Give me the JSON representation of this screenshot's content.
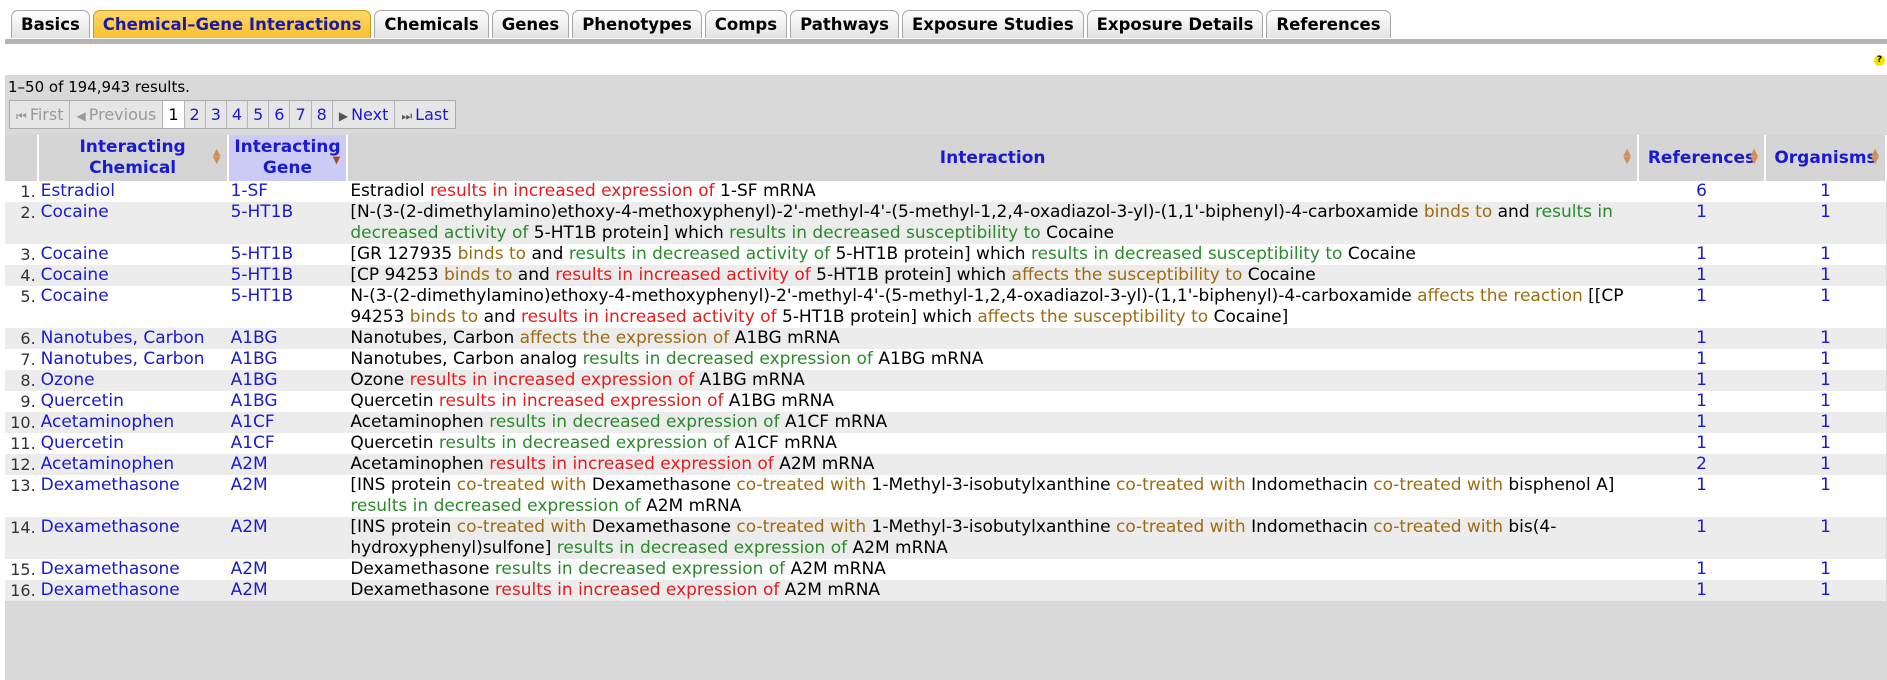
{
  "tabs": [
    {
      "label": "Basics",
      "active": false
    },
    {
      "label": "Chemical–Gene Interactions",
      "active": true
    },
    {
      "label": "Chemicals",
      "active": false
    },
    {
      "label": "Genes",
      "active": false
    },
    {
      "label": "Phenotypes",
      "active": false
    },
    {
      "label": "Comps",
      "active": false
    },
    {
      "label": "Pathways",
      "active": false
    },
    {
      "label": "Exposure Studies",
      "active": false
    },
    {
      "label": "Exposure Details",
      "active": false
    },
    {
      "label": "References",
      "active": false
    }
  ],
  "help_icon": "?",
  "results_count": "1–50 of 194,943 results.",
  "pager": {
    "first": "First",
    "previous": "Previous",
    "pages": [
      "1",
      "2",
      "3",
      "4",
      "5",
      "6",
      "7",
      "8"
    ],
    "current": "1",
    "next": "Next",
    "last": "Last"
  },
  "columns": {
    "chemical": "Interacting Chemical",
    "gene": "Interacting Gene",
    "interaction": "Interaction",
    "references": "References",
    "organisms": "Organisms"
  },
  "colors": {
    "increase": "#e81a1a",
    "decrease": "#2a8a2a",
    "affects": "#9e6b10",
    "link": "#1a1ad0",
    "active_tab": "#fbc02e"
  },
  "rows": [
    {
      "n": "1.",
      "chemical": "Estradiol",
      "gene": "1-SF",
      "refs": "6",
      "orgs": "1",
      "interaction": [
        [
          "Estradiol ",
          ""
        ],
        [
          "results in increased expression of",
          "red"
        ],
        [
          " 1-SF mRNA",
          ""
        ]
      ]
    },
    {
      "n": "2.",
      "chemical": "Cocaine",
      "gene": "5-HT1B",
      "refs": "1",
      "orgs": "1",
      "interaction": [
        [
          "[N-(3-(2-dimethylamino)ethoxy-4-methoxyphenyl)-2'-methyl-4'-(5-methyl-1,2,4-oxadiazol-3-yl)-(1,1'-biphenyl)-4-carboxamide ",
          ""
        ],
        [
          "binds to",
          "brn"
        ],
        [
          " and ",
          ""
        ],
        [
          "results in decreased activity of",
          "grn"
        ],
        [
          " 5-HT1B protein] which ",
          ""
        ],
        [
          "results in decreased susceptibility to",
          "grn"
        ],
        [
          " Cocaine",
          ""
        ]
      ]
    },
    {
      "n": "3.",
      "chemical": "Cocaine",
      "gene": "5-HT1B",
      "refs": "1",
      "orgs": "1",
      "interaction": [
        [
          "[GR 127935 ",
          ""
        ],
        [
          "binds to",
          "brn"
        ],
        [
          " and ",
          ""
        ],
        [
          "results in decreased activity of",
          "grn"
        ],
        [
          " 5-HT1B protein] which ",
          ""
        ],
        [
          "results in decreased susceptibility to",
          "grn"
        ],
        [
          " Cocaine",
          ""
        ]
      ]
    },
    {
      "n": "4.",
      "chemical": "Cocaine",
      "gene": "5-HT1B",
      "refs": "1",
      "orgs": "1",
      "interaction": [
        [
          "[CP 94253 ",
          ""
        ],
        [
          "binds to",
          "brn"
        ],
        [
          " and ",
          ""
        ],
        [
          "results in increased activity of",
          "red"
        ],
        [
          " 5-HT1B protein] which ",
          ""
        ],
        [
          "affects the susceptibility to",
          "brn"
        ],
        [
          " Cocaine",
          ""
        ]
      ]
    },
    {
      "n": "5.",
      "chemical": "Cocaine",
      "gene": "5-HT1B",
      "refs": "1",
      "orgs": "1",
      "interaction": [
        [
          "N-(3-(2-dimethylamino)ethoxy-4-methoxyphenyl)-2'-methyl-4'-(5-methyl-1,2,4-oxadiazol-3-yl)-(1,1'-biphenyl)-4-carboxamide ",
          ""
        ],
        [
          "affects the reaction",
          "brn"
        ],
        [
          " [[CP 94253 ",
          ""
        ],
        [
          "binds to",
          "brn"
        ],
        [
          " and ",
          ""
        ],
        [
          "results in increased activity of",
          "red"
        ],
        [
          " 5-HT1B protein] which ",
          ""
        ],
        [
          "affects the susceptibility to",
          "brn"
        ],
        [
          " Cocaine]",
          ""
        ]
      ]
    },
    {
      "n": "6.",
      "chemical": "Nanotubes, Carbon",
      "gene": "A1BG",
      "refs": "1",
      "orgs": "1",
      "interaction": [
        [
          "Nanotubes, Carbon ",
          ""
        ],
        [
          "affects the expression of",
          "brn"
        ],
        [
          " A1BG mRNA",
          ""
        ]
      ]
    },
    {
      "n": "7.",
      "chemical": "Nanotubes, Carbon",
      "gene": "A1BG",
      "refs": "1",
      "orgs": "1",
      "interaction": [
        [
          "Nanotubes, Carbon analog ",
          ""
        ],
        [
          "results in decreased expression of",
          "grn"
        ],
        [
          " A1BG mRNA",
          ""
        ]
      ]
    },
    {
      "n": "8.",
      "chemical": "Ozone",
      "gene": "A1BG",
      "refs": "1",
      "orgs": "1",
      "interaction": [
        [
          "Ozone ",
          ""
        ],
        [
          "results in increased expression of",
          "red"
        ],
        [
          " A1BG mRNA",
          ""
        ]
      ]
    },
    {
      "n": "9.",
      "chemical": "Quercetin",
      "gene": "A1BG",
      "refs": "1",
      "orgs": "1",
      "interaction": [
        [
          "Quercetin ",
          ""
        ],
        [
          "results in increased expression of",
          "red"
        ],
        [
          " A1BG mRNA",
          ""
        ]
      ]
    },
    {
      "n": "10.",
      "chemical": "Acetaminophen",
      "gene": "A1CF",
      "refs": "1",
      "orgs": "1",
      "interaction": [
        [
          "Acetaminophen ",
          ""
        ],
        [
          "results in decreased expression of",
          "grn"
        ],
        [
          " A1CF mRNA",
          ""
        ]
      ]
    },
    {
      "n": "11.",
      "chemical": "Quercetin",
      "gene": "A1CF",
      "refs": "1",
      "orgs": "1",
      "interaction": [
        [
          "Quercetin ",
          ""
        ],
        [
          "results in decreased expression of",
          "grn"
        ],
        [
          " A1CF mRNA",
          ""
        ]
      ]
    },
    {
      "n": "12.",
      "chemical": "Acetaminophen",
      "gene": "A2M",
      "refs": "2",
      "orgs": "1",
      "interaction": [
        [
          "Acetaminophen ",
          ""
        ],
        [
          "results in increased expression of",
          "red"
        ],
        [
          " A2M mRNA",
          ""
        ]
      ]
    },
    {
      "n": "13.",
      "chemical": "Dexamethasone",
      "gene": "A2M",
      "refs": "1",
      "orgs": "1",
      "interaction": [
        [
          "[INS protein ",
          ""
        ],
        [
          "co-treated with",
          "brn"
        ],
        [
          " Dexamethasone ",
          ""
        ],
        [
          "co-treated with",
          "brn"
        ],
        [
          " 1-Methyl-3-isobutylxanthine ",
          ""
        ],
        [
          "co-treated with",
          "brn"
        ],
        [
          " Indomethacin ",
          ""
        ],
        [
          "co-treated with",
          "brn"
        ],
        [
          " bisphenol A] ",
          ""
        ],
        [
          "results in decreased expression of",
          "grn"
        ],
        [
          " A2M mRNA",
          ""
        ]
      ]
    },
    {
      "n": "14.",
      "chemical": "Dexamethasone",
      "gene": "A2M",
      "refs": "1",
      "orgs": "1",
      "interaction": [
        [
          "[INS protein ",
          ""
        ],
        [
          "co-treated with",
          "brn"
        ],
        [
          " Dexamethasone ",
          ""
        ],
        [
          "co-treated with",
          "brn"
        ],
        [
          " 1-Methyl-3-isobutylxanthine ",
          ""
        ],
        [
          "co-treated with",
          "brn"
        ],
        [
          " Indomethacin ",
          ""
        ],
        [
          "co-treated with",
          "brn"
        ],
        [
          " bis(4-hydroxyphenyl)sulfone] ",
          ""
        ],
        [
          "results in decreased expression of",
          "grn"
        ],
        [
          " A2M mRNA",
          ""
        ]
      ]
    },
    {
      "n": "15.",
      "chemical": "Dexamethasone",
      "gene": "A2M",
      "refs": "1",
      "orgs": "1",
      "interaction": [
        [
          "Dexamethasone ",
          ""
        ],
        [
          "results in decreased expression of",
          "grn"
        ],
        [
          " A2M mRNA",
          ""
        ]
      ]
    },
    {
      "n": "16.",
      "chemical": "Dexamethasone",
      "gene": "A2M",
      "refs": "1",
      "orgs": "1",
      "interaction": [
        [
          "Dexamethasone ",
          ""
        ],
        [
          "results in increased expression of",
          "red"
        ],
        [
          " A2M mRNA",
          ""
        ]
      ]
    }
  ]
}
